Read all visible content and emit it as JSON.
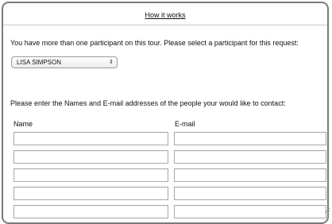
{
  "header": {
    "how_it_works_link": "How it works"
  },
  "participant": {
    "prompt": "You have more than one participant on this tour. Please select a participant for this request:",
    "selected": "LISA SIMPSON",
    "select_arrows_icon": "up-down-arrows-icon"
  },
  "contacts": {
    "prompt": "Please enter the Names and E-mail addresses of the people your would like to contact:",
    "columns": {
      "name": "Name",
      "email": "E-mail"
    },
    "rows": [
      {
        "name": "",
        "email": ""
      },
      {
        "name": "",
        "email": ""
      },
      {
        "name": "",
        "email": ""
      },
      {
        "name": "",
        "email": ""
      },
      {
        "name": "",
        "email": ""
      }
    ]
  }
}
